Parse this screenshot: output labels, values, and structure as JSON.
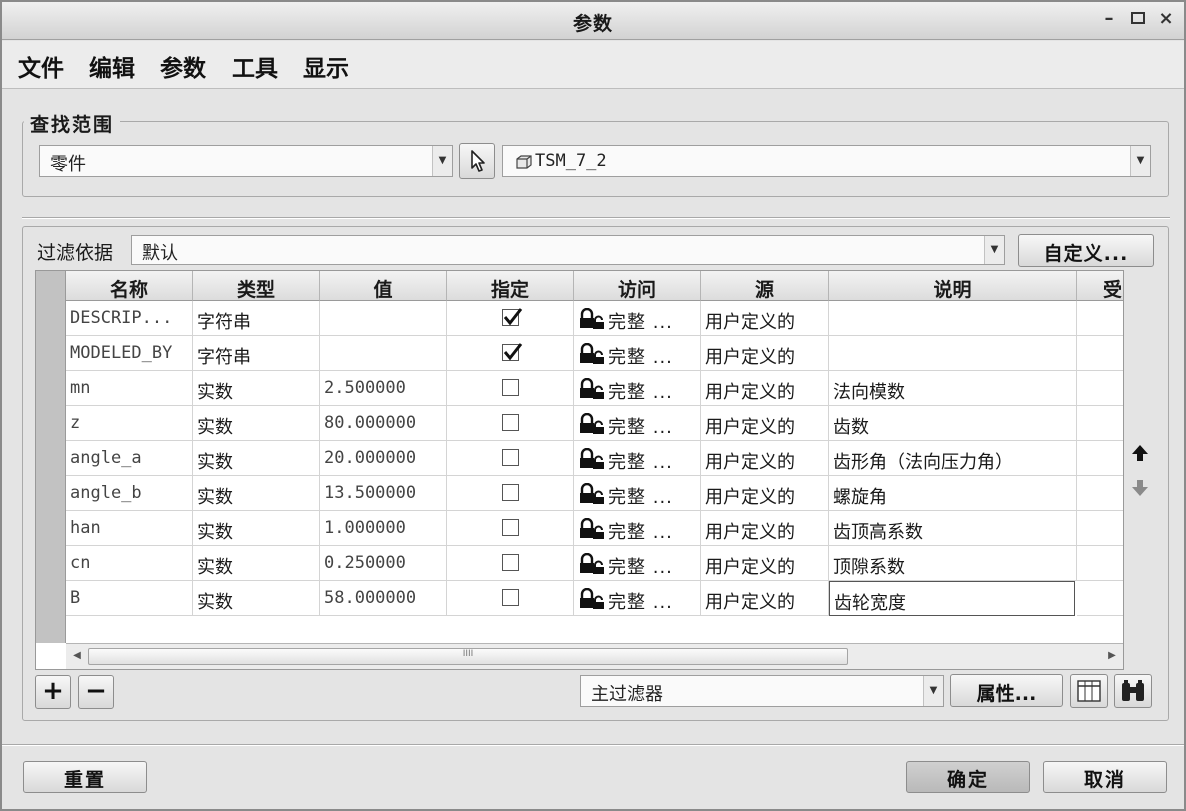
{
  "window": {
    "title": "参数"
  },
  "menu": [
    "文件",
    "编辑",
    "参数",
    "工具",
    "显示"
  ],
  "scope": {
    "group_title": "查找范围",
    "type_value": "零件",
    "model_value": "TSM_7_2"
  },
  "filter": {
    "label": "过滤依据",
    "value": "默认",
    "customize_label": "自定义..."
  },
  "table": {
    "columns": [
      "名称",
      "类型",
      "值",
      "指定",
      "访问",
      "源",
      "说明",
      "受"
    ],
    "rows": [
      {
        "name": "DESCRIP...",
        "type": "字符串",
        "value": "",
        "designated": true,
        "access": "完整 ...",
        "source": "用户定义的",
        "description": ""
      },
      {
        "name": "MODELED_BY",
        "type": "字符串",
        "value": "",
        "designated": true,
        "access": "完整 ...",
        "source": "用户定义的",
        "description": ""
      },
      {
        "name": "mn",
        "type": "实数",
        "value": "2.500000",
        "designated": false,
        "access": "完整 ...",
        "source": "用户定义的",
        "description": "法向模数"
      },
      {
        "name": "z",
        "type": "实数",
        "value": "80.000000",
        "designated": false,
        "access": "完整 ...",
        "source": "用户定义的",
        "description": "齿数"
      },
      {
        "name": "angle_a",
        "type": "实数",
        "value": "20.000000",
        "designated": false,
        "access": "完整 ...",
        "source": "用户定义的",
        "description": "齿形角（法向压力角）"
      },
      {
        "name": "angle_b",
        "type": "实数",
        "value": "13.500000",
        "designated": false,
        "access": "完整 ...",
        "source": "用户定义的",
        "description": "螺旋角"
      },
      {
        "name": "han",
        "type": "实数",
        "value": "1.000000",
        "designated": false,
        "access": "完整 ...",
        "source": "用户定义的",
        "description": "齿顶高系数"
      },
      {
        "name": "cn",
        "type": "实数",
        "value": "0.250000",
        "designated": false,
        "access": "完整 ...",
        "source": "用户定义的",
        "description": "顶隙系数"
      },
      {
        "name": "B",
        "type": "实数",
        "value": "58.000000",
        "designated": false,
        "access": "完整 ...",
        "source": "用户定义的",
        "description": "齿轮宽度"
      }
    ],
    "scroll_grip": "IIII"
  },
  "toolbar": {
    "add_label": "+",
    "remove_label": "−",
    "main_filter_value": "主过滤器",
    "properties_label": "属性..."
  },
  "footer": {
    "reset_label": "重置",
    "ok_label": "确定",
    "cancel_label": "取消"
  }
}
